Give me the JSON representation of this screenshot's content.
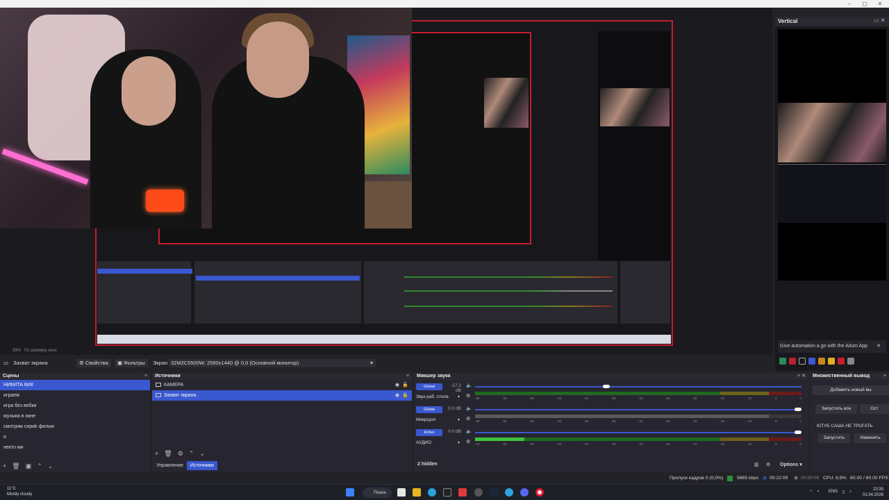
{
  "vertical_dock": {
    "title": "Vertical",
    "banner": "Give automation a go with the Aitum App",
    "banner_close": "✕"
  },
  "zoom": {
    "value": "39%",
    "fit": "По размеру окна"
  },
  "toolbar": {
    "scene_label": "Захват экрана",
    "properties": "Свойства",
    "filters": "Фильтры",
    "screen_label": "Экран",
    "screen_value": "32M2C5500W: 2560x1440 @ 0,0 (Основной монитор)"
  },
  "scenes": {
    "title": "Сцены",
    "items": [
      "НИКИТА КИК",
      "играем",
      "игра без вебки",
      "музыка в окне",
      "смотрим сериk фильм",
      "я",
      "некто ми"
    ],
    "footer": [
      "+",
      "🗑",
      "▣",
      "⌃",
      "⌄"
    ]
  },
  "sources": {
    "title": "Источники",
    "items": [
      "КАМЕРА",
      "Захват экрана"
    ],
    "footer": [
      "+",
      "🗑",
      "⚙",
      "⌃",
      "⌄"
    ],
    "tabs": [
      "Управление",
      "Источники"
    ]
  },
  "mixer": {
    "title": "Микшер звука",
    "channels": [
      {
        "badge": "Global",
        "db": "-27.2 dB",
        "name": "Звук раб. стола",
        "level": 0.4
      },
      {
        "badge": "Global",
        "db": "0.0 dB",
        "name": "Микр/доп",
        "level": 1.0
      },
      {
        "badge": "Active",
        "db": "0.0 dB",
        "name": "АУДИО",
        "level": 1.0
      }
    ],
    "ticks": [
      "-60",
      "-55",
      "-50",
      "-45",
      "-40",
      "-35",
      "-30",
      "-25",
      "-20",
      "-15",
      "-10",
      "-5",
      "0"
    ],
    "hidden": "2 hidden",
    "options": "Options"
  },
  "multi_output": {
    "title": "Множественный вывод",
    "add_new": "Добавить новый вы",
    "start_all": "Запустить все",
    "stop_all": "Ост",
    "target_name": "ЮТУБ САША НЕ ТРОГАТЬ",
    "start": "Запустить",
    "edit": "Изменить"
  },
  "status": {
    "dropped": "Пропуск кадров 0 (0,0%)",
    "bitrate": "5665 kbps",
    "time": "00:22:09",
    "rec_time": "00:00:00",
    "cpu": "CPU: 8,9%",
    "fps": "60.00 / 60.00 FPS"
  },
  "taskbar": {
    "weather_temp": "11°C",
    "weather_desc": "Mostly cloudy",
    "search": "Поиск",
    "lang": "ENG",
    "clock_time": "23:35",
    "clock_date": "01.04.2026"
  },
  "colors": {
    "accent": "#3a58d0",
    "record": "#c41e2f",
    "meter_green": "#2d8a2d",
    "meter_yellow": "#8a7a1f",
    "meter_red": "#8a1f1f"
  }
}
